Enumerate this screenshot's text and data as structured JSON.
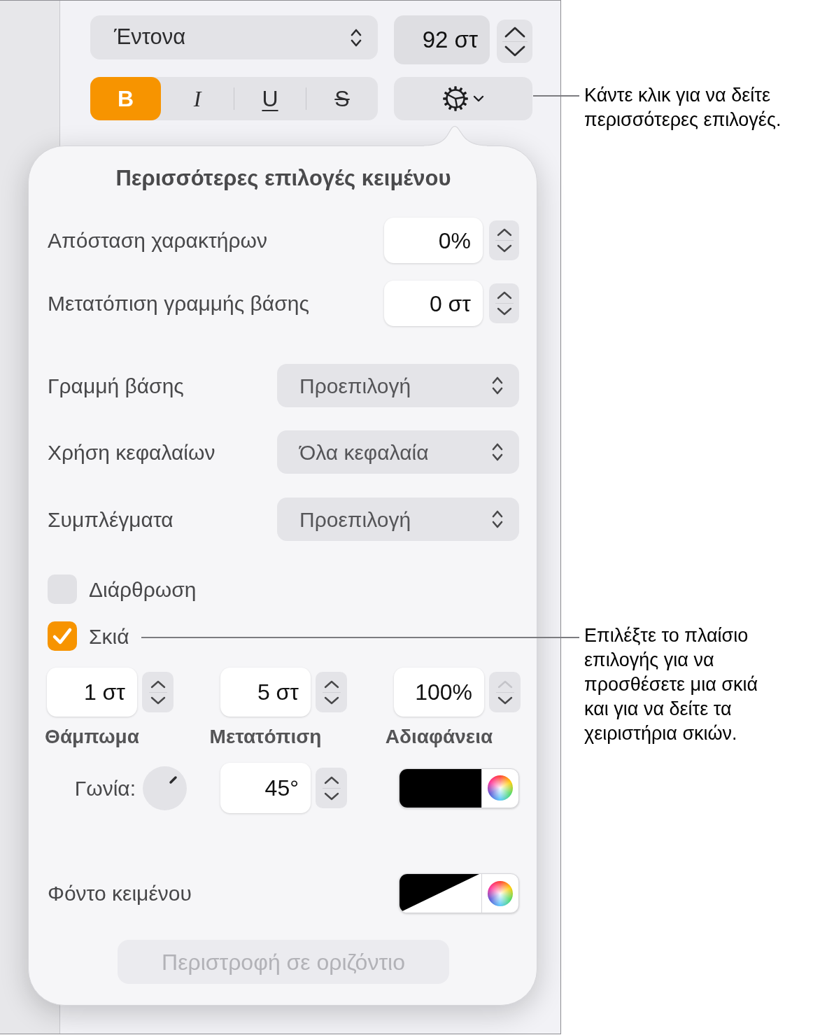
{
  "toolbar": {
    "font_style": "Έντονα",
    "font_size": "92 στ",
    "format_buttons": [
      {
        "kind": "bold",
        "label": "B",
        "selected": true
      },
      {
        "kind": "italic",
        "label": "I",
        "selected": false
      },
      {
        "kind": "underline",
        "label": "U",
        "selected": false
      },
      {
        "kind": "strikethrough",
        "label": "S",
        "selected": false
      }
    ]
  },
  "popover": {
    "title": "Περισσότερες επιλογές κειμένου",
    "rows": [
      {
        "kind": "stepper",
        "label": "Απόσταση χαρακτήρων",
        "value": "0%"
      },
      {
        "kind": "stepper",
        "label": "Μετατόπιση γραμμής βάσης",
        "value": "0 στ"
      },
      {
        "kind": "popup",
        "label": "Γραμμή βάσης",
        "value": "Προεπιλογή"
      },
      {
        "kind": "popup",
        "label": "Χρήση κεφαλαίων",
        "value": "Όλα κεφαλαία"
      },
      {
        "kind": "popup",
        "label": "Συμπλέγματα",
        "value": "Προεπιλογή"
      }
    ],
    "checkboxes": [
      {
        "label": "Διάρθρωση",
        "checked": false
      },
      {
        "label": "Σκιά",
        "checked": true
      }
    ],
    "shadow": {
      "fields": [
        {
          "value": "1 στ",
          "label": "Θάμπωμα",
          "up_disabled": false
        },
        {
          "value": "5 στ",
          "label": "Μετατόπιση",
          "up_disabled": false
        },
        {
          "value": "100%",
          "label": "Αδιαφάνεια",
          "up_disabled": true
        }
      ],
      "angle": {
        "label": "Γωνία:",
        "value": "45°"
      }
    },
    "text_background": {
      "label": "Φόντο κειμένου"
    },
    "rotate_button": {
      "label": "Περιστροφή σε οριζόντιο",
      "disabled": true
    }
  },
  "callouts": [
    "Κάντε κλικ για να δείτε περισσότερες επιλογές.",
    "Επιλέξτε το πλαίσιο επιλογής για να προσθέσετε μια σκιά και για να δείτε τα χειριστήρια σκιών."
  ]
}
